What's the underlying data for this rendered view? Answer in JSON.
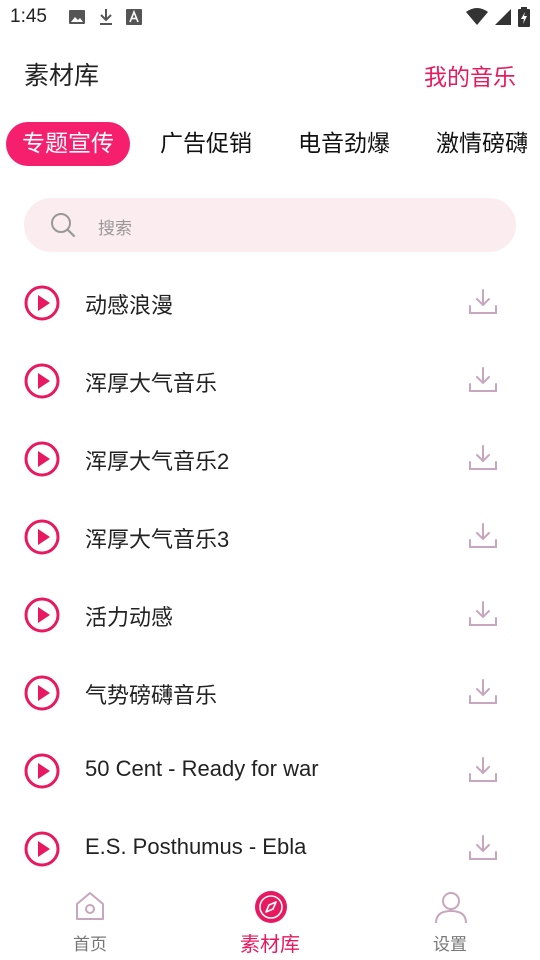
{
  "status_bar": {
    "time": "1:45"
  },
  "header": {
    "title": "素材库",
    "my_music": "我的音乐"
  },
  "tabs": [
    {
      "label": "专题宣传",
      "active": true
    },
    {
      "label": "广告促销",
      "active": false
    },
    {
      "label": "电音劲爆",
      "active": false
    },
    {
      "label": "激情磅礴",
      "active": false
    }
  ],
  "search": {
    "placeholder": "搜索"
  },
  "songs": [
    {
      "title": "动感浪漫"
    },
    {
      "title": "浑厚大气音乐"
    },
    {
      "title": "浑厚大气音乐2"
    },
    {
      "title": "浑厚大气音乐3"
    },
    {
      "title": "活力动感"
    },
    {
      "title": "气势磅礴音乐"
    },
    {
      "title": "50 Cent - Ready for war"
    },
    {
      "title": "E.S. Posthumus - Ebla"
    }
  ],
  "bottom_nav": [
    {
      "label": "首页",
      "icon": "home-icon",
      "active": false
    },
    {
      "label": "素材库",
      "icon": "compass-icon",
      "active": true
    },
    {
      "label": "设置",
      "icon": "person-icon",
      "active": false
    }
  ],
  "colors": {
    "accent": "#e8195f",
    "tab_active_bg": "#f51f6e",
    "search_bg": "#fbecef",
    "download_icon": "#c8a6bd"
  }
}
